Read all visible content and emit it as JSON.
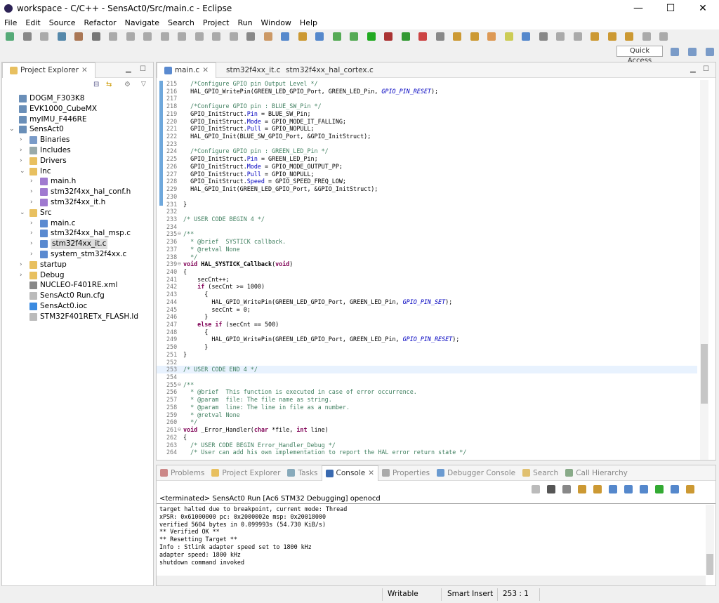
{
  "window": {
    "title": "workspace - C/C++ - SensAct0/Src/main.c - Eclipse",
    "minimize": "—",
    "maximize": "☐",
    "close": "✕"
  },
  "menu": [
    "File",
    "Edit",
    "Source",
    "Refactor",
    "Navigate",
    "Search",
    "Project",
    "Run",
    "Window",
    "Help"
  ],
  "quick_access": "Quick Access",
  "explorer": {
    "title": "Project Explorer",
    "items": [
      {
        "label": "DOGM_F303K8",
        "level": 0,
        "arrow": "",
        "icon": "project",
        "color": "#6a8fb8"
      },
      {
        "label": "EVK1000_CubeMX",
        "level": 0,
        "arrow": "",
        "icon": "project",
        "color": "#6a8fb8"
      },
      {
        "label": "myIMU_F446RE",
        "level": 0,
        "arrow": "",
        "icon": "project",
        "color": "#6a8fb8"
      },
      {
        "label": "SensAct0",
        "level": 0,
        "arrow": "v",
        "icon": "project-open",
        "color": "#6a8fb8"
      },
      {
        "label": "Binaries",
        "level": 1,
        "arrow": ">",
        "icon": "binaries",
        "color": "#7a9bc8"
      },
      {
        "label": "Includes",
        "level": 1,
        "arrow": ">",
        "icon": "includes",
        "color": "#9aa"
      },
      {
        "label": "Drivers",
        "level": 1,
        "arrow": ">",
        "icon": "folder",
        "color": "#e8c060"
      },
      {
        "label": "Inc",
        "level": 1,
        "arrow": "v",
        "icon": "folder",
        "color": "#e8c060"
      },
      {
        "label": "main.h",
        "level": 2,
        "arrow": ">",
        "icon": "h-file",
        "color": "#a07ad0"
      },
      {
        "label": "stm32f4xx_hal_conf.h",
        "level": 2,
        "arrow": ">",
        "icon": "h-file",
        "color": "#a07ad0"
      },
      {
        "label": "stm32f4xx_it.h",
        "level": 2,
        "arrow": ">",
        "icon": "h-file",
        "color": "#a07ad0"
      },
      {
        "label": "Src",
        "level": 1,
        "arrow": "v",
        "icon": "folder",
        "color": "#e8c060"
      },
      {
        "label": "main.c",
        "level": 2,
        "arrow": ">",
        "icon": "c-file",
        "color": "#5a8ad0"
      },
      {
        "label": "stm32f4xx_hal_msp.c",
        "level": 2,
        "arrow": ">",
        "icon": "c-file",
        "color": "#5a8ad0"
      },
      {
        "label": "stm32f4xx_it.c",
        "level": 2,
        "arrow": ">",
        "icon": "c-file",
        "color": "#5a8ad0",
        "selected": true
      },
      {
        "label": "system_stm32f4xx.c",
        "level": 2,
        "arrow": ">",
        "icon": "c-file",
        "color": "#5a8ad0"
      },
      {
        "label": "startup",
        "level": 1,
        "arrow": ">",
        "icon": "folder",
        "color": "#e8c060"
      },
      {
        "label": "Debug",
        "level": 1,
        "arrow": ">",
        "icon": "folder",
        "color": "#e8c060"
      },
      {
        "label": "NUCLEO-F401RE.xml",
        "level": 1,
        "arrow": "",
        "icon": "xml-file",
        "color": "#888"
      },
      {
        "label": "SensAct0 Run.cfg",
        "level": 1,
        "arrow": "",
        "icon": "file",
        "color": "#bbb"
      },
      {
        "label": "SensAct0.ioc",
        "level": 1,
        "arrow": "",
        "icon": "ioc-file",
        "color": "#3a8ae0"
      },
      {
        "label": "STM32F401RETx_FLASH.ld",
        "level": 1,
        "arrow": "",
        "icon": "file",
        "color": "#bbb"
      }
    ]
  },
  "editor": {
    "tabs": [
      {
        "label": "main.c",
        "active": true
      },
      {
        "label": "stm32f4xx_it.c"
      },
      {
        "label": "stm32f4xx_hal_cortex.c"
      }
    ],
    "current_line": 253,
    "lines": [
      {
        "n": "215",
        "t": "  /*Configure GPIO pin Output Level */"
      },
      {
        "n": "216",
        "t": "  HAL_GPIO_WritePin(GREEN_LED_GPIO_Port, GREEN_LED_Pin, GPIO_PIN_RESET);"
      },
      {
        "n": "217",
        "t": ""
      },
      {
        "n": "218",
        "t": "  /*Configure GPIO pin : BLUE_SW_Pin */"
      },
      {
        "n": "219",
        "t": "  GPIO_InitStruct.Pin = BLUE_SW_Pin;"
      },
      {
        "n": "220",
        "t": "  GPIO_InitStruct.Mode = GPIO_MODE_IT_FALLING;"
      },
      {
        "n": "221",
        "t": "  GPIO_InitStruct.Pull = GPIO_NOPULL;"
      },
      {
        "n": "222",
        "t": "  HAL_GPIO_Init(BLUE_SW_GPIO_Port, &GPIO_InitStruct);"
      },
      {
        "n": "223",
        "t": ""
      },
      {
        "n": "224",
        "t": "  /*Configure GPIO pin : GREEN_LED_Pin */"
      },
      {
        "n": "225",
        "t": "  GPIO_InitStruct.Pin = GREEN_LED_Pin;"
      },
      {
        "n": "226",
        "t": "  GPIO_InitStruct.Mode = GPIO_MODE_OUTPUT_PP;"
      },
      {
        "n": "227",
        "t": "  GPIO_InitStruct.Pull = GPIO_NOPULL;"
      },
      {
        "n": "228",
        "t": "  GPIO_InitStruct.Speed = GPIO_SPEED_FREQ_LOW;"
      },
      {
        "n": "229",
        "t": "  HAL_GPIO_Init(GREEN_LED_GPIO_Port, &GPIO_InitStruct);"
      },
      {
        "n": "230",
        "t": ""
      },
      {
        "n": "231",
        "t": "}"
      },
      {
        "n": "232",
        "t": ""
      },
      {
        "n": "233",
        "t": "/* USER CODE BEGIN 4 */"
      },
      {
        "n": "234",
        "t": ""
      },
      {
        "n": "235",
        "t": "/**",
        "fold": true
      },
      {
        "n": "236",
        "t": "  * @brief  SYSTICK callback."
      },
      {
        "n": "237",
        "t": "  * @retval None"
      },
      {
        "n": "238",
        "t": "  */"
      },
      {
        "n": "239",
        "t": "void HAL_SYSTICK_Callback(void)",
        "fold": true
      },
      {
        "n": "240",
        "t": "{"
      },
      {
        "n": "241",
        "t": "    secCnt++;"
      },
      {
        "n": "242",
        "t": "    if (secCnt >= 1000)"
      },
      {
        "n": "243",
        "t": "      {"
      },
      {
        "n": "244",
        "t": "        HAL_GPIO_WritePin(GREEN_LED_GPIO_Port, GREEN_LED_Pin, GPIO_PIN_SET);"
      },
      {
        "n": "245",
        "t": "        secCnt = 0;"
      },
      {
        "n": "246",
        "t": "      }"
      },
      {
        "n": "247",
        "t": "    else if (secCnt == 500)"
      },
      {
        "n": "248",
        "t": "      {"
      },
      {
        "n": "249",
        "t": "        HAL_GPIO_WritePin(GREEN_LED_GPIO_Port, GREEN_LED_Pin, GPIO_PIN_RESET);"
      },
      {
        "n": "250",
        "t": "      }"
      },
      {
        "n": "251",
        "t": "}"
      },
      {
        "n": "252",
        "t": ""
      },
      {
        "n": "253",
        "t": "/* USER CODE END 4 */"
      },
      {
        "n": "254",
        "t": ""
      },
      {
        "n": "255",
        "t": "/**",
        "fold": true
      },
      {
        "n": "256",
        "t": "  * @brief  This function is executed in case of error occurrence."
      },
      {
        "n": "257",
        "t": "  * @param  file: The file name as string."
      },
      {
        "n": "258",
        "t": "  * @param  line: The line in file as a number."
      },
      {
        "n": "259",
        "t": "  * @retval None"
      },
      {
        "n": "260",
        "t": "  */"
      },
      {
        "n": "261",
        "t": "void _Error_Handler(char *file, int line)",
        "fold": true
      },
      {
        "n": "262",
        "t": "{"
      },
      {
        "n": "263",
        "t": "  /* USER CODE BEGIN Error_Handler_Debug */"
      },
      {
        "n": "264",
        "t": "  /* User can add his own implementation to report the HAL error return state */"
      }
    ]
  },
  "bottom": {
    "tabs": [
      {
        "label": "Problems",
        "color": "#c88"
      },
      {
        "label": "Project Explorer",
        "color": "#e8c060"
      },
      {
        "label": "Tasks",
        "color": "#8ab"
      },
      {
        "label": "Console",
        "active": true,
        "color": "#3a6ab0"
      },
      {
        "label": "Properties",
        "color": "#aaa"
      },
      {
        "label": "Debugger Console",
        "color": "#6a9ad0"
      },
      {
        "label": "Search",
        "color": "#e0c070"
      },
      {
        "label": "Call Hierarchy",
        "color": "#8a8"
      }
    ],
    "console_header": "<terminated> SensAct0 Run [Ac6 STM32 Debugging] openocd",
    "console_lines": [
      "target halted due to breakpoint, current mode: Thread",
      "xPSR: 0x61000000 pc: 0x2000002e msp: 0x20018000",
      "verified 5604 bytes in 0.099993s (54.730 KiB/s)",
      "** Verified OK **",
      "** Resetting Target **",
      "Info : Stlink adapter speed set to 1800 kHz",
      "adapter speed: 1800 kHz",
      "shutdown command invoked"
    ]
  },
  "status": {
    "mode": "Writable",
    "insert": "Smart Insert",
    "position": "253 : 1"
  }
}
